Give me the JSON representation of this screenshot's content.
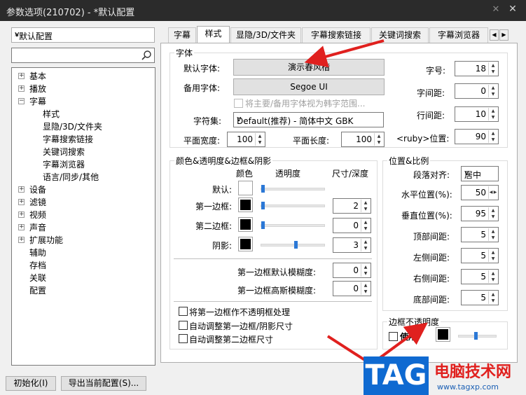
{
  "window": {
    "title": "参数选项(210702) - *默认配置",
    "pin_icon": "pin-icon",
    "close_icon": "close-icon"
  },
  "sidebar": {
    "profile": "*默认配置",
    "search_value": "",
    "tree": [
      {
        "label": "基本",
        "expander": "+"
      },
      {
        "label": "播放",
        "expander": "+"
      },
      {
        "label": "字幕",
        "expander": "-"
      },
      {
        "label": "样式"
      },
      {
        "label": "显隐/3D/文件夹"
      },
      {
        "label": "字幕搜索链接"
      },
      {
        "label": "关键词搜索"
      },
      {
        "label": "字幕浏览器"
      },
      {
        "label": "语言/同步/其他"
      },
      {
        "label": "设备",
        "expander": "+"
      },
      {
        "label": "滤镜",
        "expander": "+"
      },
      {
        "label": "视频",
        "expander": "+"
      },
      {
        "label": "声音",
        "expander": "+"
      },
      {
        "label": "扩展功能",
        "expander": "+"
      },
      {
        "label": "辅助"
      },
      {
        "label": "存档"
      },
      {
        "label": "关联"
      },
      {
        "label": "配置"
      }
    ]
  },
  "tabs": [
    "字幕",
    "样式",
    "显隐/3D/文件夹",
    "字幕搜索链接",
    "关键词搜索",
    "字幕浏览器"
  ],
  "font_group": {
    "title": "字体",
    "default_font_label": "默认字体:",
    "default_font_value": "演示春风楷",
    "backup_font_label": "备用字体:",
    "backup_font_value": "Segoe UI",
    "korean_checkbox_label": "将主要/备用字体视为韩字范围...",
    "charset_label": "字符集:",
    "charset_value": "Default(推荐) - 简体中文 GBK",
    "width_label": "平面宽度:",
    "width_value": "100",
    "length_label": "平面长度:",
    "length_value": "100",
    "size_label": "字号:",
    "size_value": "18",
    "char_spacing_label": "字间距:",
    "char_spacing_value": "0",
    "line_spacing_label": "行间距:",
    "line_spacing_value": "10",
    "ruby_label": "<ruby>位置:",
    "ruby_value": "90"
  },
  "color_group": {
    "title": "颜色&透明度&边框&阴影",
    "col_color": "颜色",
    "col_opacity": "透明度",
    "col_size": "尺寸/深度",
    "rows": [
      {
        "label": "默认:",
        "color": "#ffffff",
        "opacity": 0.0,
        "size": null
      },
      {
        "label": "第一边框:",
        "color": "#000000",
        "opacity": 0.0,
        "size": "2"
      },
      {
        "label": "第二边框:",
        "color": "#000000",
        "opacity": 0.0,
        "size": "0"
      },
      {
        "label": "阴影:",
        "color": "#000000",
        "opacity": 0.55,
        "size": "3"
      }
    ],
    "blur1_label": "第一边框默认模糊度:",
    "blur1_value": "0",
    "blur2_label": "第一边框高斯模糊度:",
    "blur2_value": "0",
    "check1": "将第一边框作不透明框处理",
    "check2": "自动调整第一边框/阴影尺寸",
    "check3": "自动调整第二边框尺寸"
  },
  "position_group": {
    "title": "位置&比例",
    "align_label": "段落对齐:",
    "align_value": "居中",
    "hpos_label": "水平位置(%):",
    "hpos_value": "50",
    "vpos_label": "垂直位置(%):",
    "vpos_value": "95",
    "top_label": "顶部间距:",
    "top_value": "5",
    "left_label": "左侧间距:",
    "left_value": "5",
    "right_label": "右侧间距:",
    "right_value": "5",
    "bottom_label": "底部间距:",
    "bottom_value": "5"
  },
  "border_opacity_group": {
    "title": "边框不透明度",
    "use_label": "使用",
    "color": "#000000",
    "opacity": 0.45
  },
  "footer": {
    "reset": "初始化(I)",
    "export": "导出当前配置(S)..."
  },
  "watermark": {
    "badge": "TAG",
    "site_name": "电脑技术网",
    "url": "www.tagxp.com"
  },
  "colors": {
    "titlebar": "#2b2b2b",
    "accent": "#2b78d6",
    "annotation_arrow": "#e0201e"
  }
}
